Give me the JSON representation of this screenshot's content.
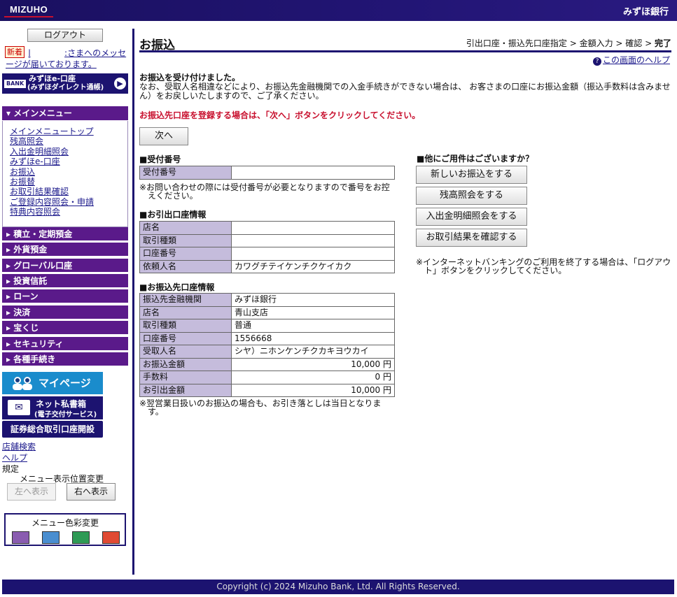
{
  "header": {
    "logo": "MIZUHO",
    "bank_name": "みずほ銀行"
  },
  "sidebar": {
    "logout_label": "ログアウト",
    "new_badge": "新着",
    "message_prefix": "|",
    "message_text": ":さまへのメッセージが届いております。",
    "eaccount_bank": "BANK",
    "eaccount_line1": "みずほe-口座",
    "eaccount_line2": "(みずほダイレクト通帳)",
    "main_menu_title": "メインメニュー",
    "main_menu_items": [
      "メインメニュートップ",
      "残高照会",
      "入出金明細照会",
      "みずほe-口座",
      "お振込",
      "お振替",
      "お取引結果確認",
      "ご登録内容照会・申請",
      "特典内容照会"
    ],
    "categories": [
      "積立・定期預金",
      "外貨預金",
      "グローバル口座",
      "投資信託",
      "ローン",
      "決済",
      "宝くじ",
      "セキュリティ",
      "各種手続き"
    ],
    "mypage_label": "マイページ",
    "mailbox_line1": "ネット私書箱",
    "mailbox_line2": "(電子交付サービス)",
    "securities_label": "証券総合取引口座開設",
    "links": [
      "店舗検索",
      "ヘルプ"
    ],
    "rules_label": "規定",
    "menu_position_label": "メニュー表示位置変更",
    "left_button": "左へ表示",
    "right_button": "右へ表示",
    "color_change_label": "メニュー色彩変更",
    "color_swatches": [
      "#8a5cb0",
      "#4a8ed0",
      "#2e9a55",
      "#e04a33"
    ]
  },
  "main": {
    "title": "お振込",
    "steps_prefix": "引出口座・振込先口座指定 > 金額入力 > 確認 > ",
    "steps_current": "完了",
    "help_label": "この画面のヘルプ",
    "done_bold": "お振込を受け付けました。",
    "done_text": "なお、受取人名相違などにより、お振込先金融機関での入金手続きができない場合は、 お客さまの口座にお振込金額（振込手数料は含みません）をお戻しいたしますので、ご了承ください。",
    "notice": "お振込先口座を登録する場合は、「次へ」ボタンをクリックしてください。",
    "next_button": "次へ",
    "receipt_title": "■受付番号",
    "receipt_label": "受付番号",
    "receipt_value": "",
    "receipt_note": "※お問い合わせの際には受付番号が必要となりますので番号をお控えください。",
    "from_title": "■お引出口座情報",
    "from_rows": [
      {
        "label": "店名",
        "value": ""
      },
      {
        "label": "取引種類",
        "value": ""
      },
      {
        "label": "口座番号",
        "value": ""
      },
      {
        "label": "依頼人名",
        "value": "カワグチテイケンチクケイカク"
      }
    ],
    "to_title": "■お振込先口座情報",
    "to_rows": [
      {
        "label": "振込先金融機関",
        "value": "みずほ銀行"
      },
      {
        "label": "店名",
        "value": "青山支店"
      },
      {
        "label": "取引種類",
        "value": "普通"
      },
      {
        "label": "口座番号",
        "value": "1556668"
      },
      {
        "label": "受取人名",
        "value": "シヤ）ニホンケンチクカキヨウカイ"
      },
      {
        "label": "お振込金額",
        "value": "10,000 円"
      },
      {
        "label": "手数料",
        "value": "0 円"
      },
      {
        "label": "お引出金額",
        "value": "10,000 円"
      }
    ],
    "to_note": "※翌営業日扱いのお振込の場合も、お引き落としは当日となります。",
    "other_title": "■他にご用件はございますか？",
    "other_buttons": [
      "新しいお振込をする",
      "残高照会をする",
      "入出金明細照会をする",
      "お取引結果を確認する"
    ],
    "logout_note": "※インターネットバンキングのご利用を終了する場合は、「ログアウト」ボタンをクリックしてください。"
  },
  "footer": {
    "copyright": "Copyright (c) 2024 Mizuho Bank, Ltd. All Rights Reserved."
  }
}
